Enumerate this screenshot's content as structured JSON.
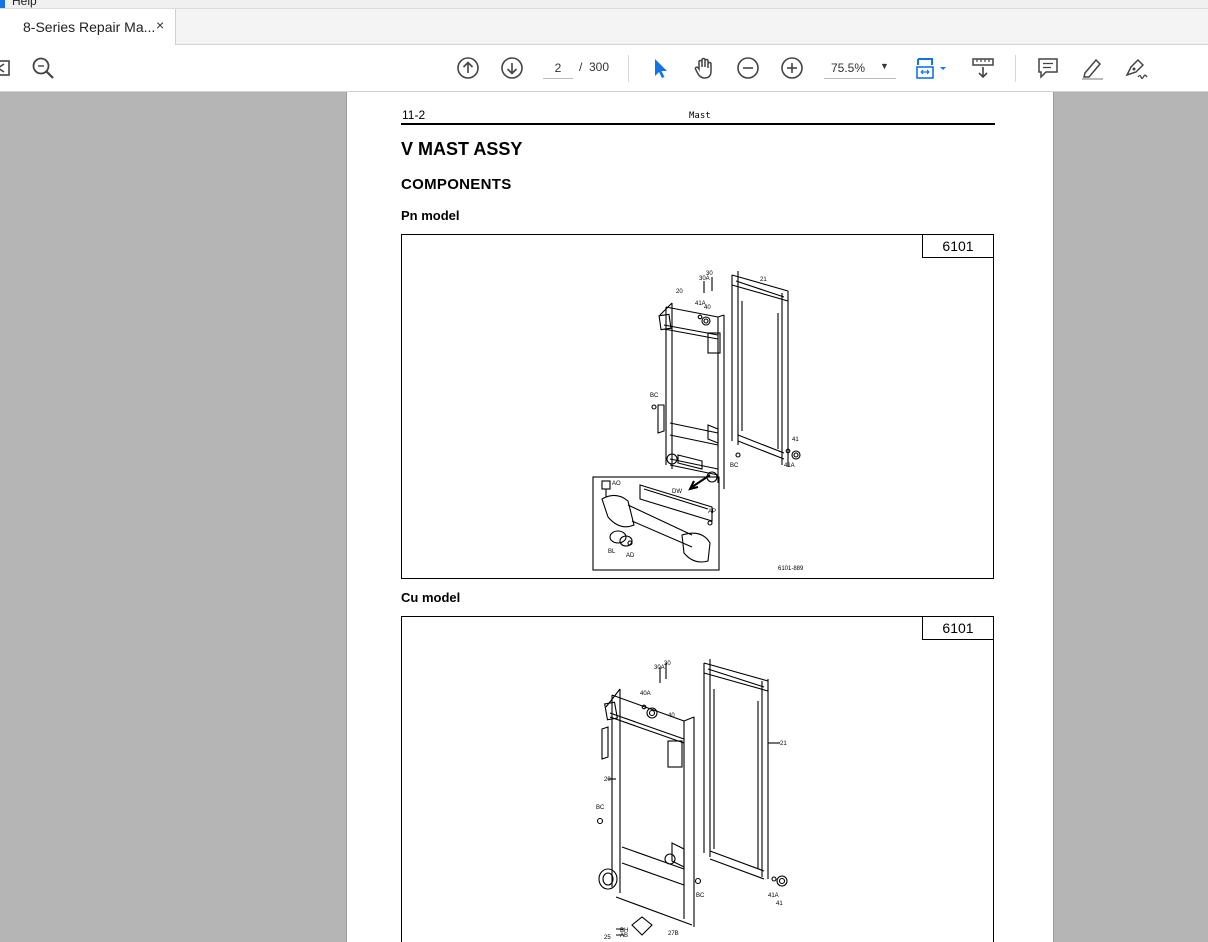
{
  "menubar": {
    "help_label": "Help"
  },
  "tab": {
    "title": "8-Series Repair Ma...",
    "close": "×"
  },
  "toolbar": {
    "page_current": "2",
    "page_separator": "/",
    "page_total": "300",
    "zoom": "75.5%",
    "zoom_caret": "▼",
    "icons": [
      "sidebar-toggle-icon",
      "search-icon",
      "previous-page-icon",
      "next-page-icon",
      "select-cursor-icon",
      "hand-icon",
      "zoom-out-icon",
      "zoom-in-icon",
      "fit-page-icon",
      "scrolling-mode-icon",
      "comment-icon",
      "highlight-icon",
      "sign-icon"
    ],
    "accent_color": "#1473e6"
  },
  "document": {
    "running_head_number": "11-2",
    "running_head_title": "Mast",
    "title": "V MAST ASSY",
    "section": "COMPONENTS",
    "figures": [
      {
        "caption": "Pn model",
        "code": "6101",
        "callouts": [
          "30A",
          "30",
          "21",
          "20",
          "41A",
          "40",
          "BC",
          "BC",
          "41",
          "41A",
          "AO",
          "DW",
          "AP",
          "BL",
          "AD"
        ],
        "drawing_id": "6101-889"
      },
      {
        "caption": "Cu model",
        "code": "6101",
        "callouts": [
          "30A",
          "30",
          "40A",
          "40",
          "21",
          "20",
          "BC",
          "BC",
          "41A",
          "41",
          "BH",
          "AB",
          "25",
          "27B"
        ]
      }
    ]
  }
}
